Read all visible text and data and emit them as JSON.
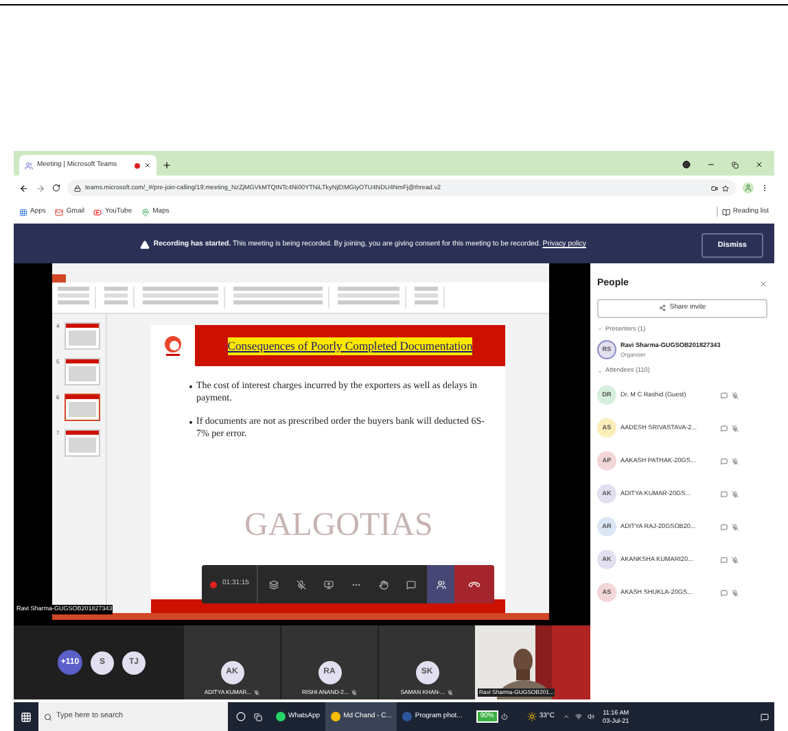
{
  "browser": {
    "tab_title": "Meeting | Microsoft Teams",
    "url": "teams.microsoft.com/_#/pre-join-calling/19:meeting_NzZjMGVkMTQtNTc4Ni00YTNiLTkyNjEtMGIyOTU4NDU4NmFj@thread.v2",
    "bookmarks": [
      "Apps",
      "Gmail",
      "YouTube",
      "Maps"
    ],
    "reading_list": "Reading list"
  },
  "banner": {
    "bold": "Recording has started.",
    "message": "This meeting is being recorded. By joining, you are giving consent for this meeting to be recorded.",
    "link": "Privacy policy",
    "button": "Dismiss"
  },
  "presentation": {
    "thumbnails": [
      {
        "number": "4",
        "selected": false
      },
      {
        "number": "5",
        "selected": false
      },
      {
        "number": "6",
        "selected": true
      },
      {
        "number": "7",
        "selected": false
      }
    ],
    "slide_title": "Consequences of Poorly Completed Documentation",
    "bullets": [
      "The cost of interest charges incurred by the exporters as well as delays in payment.",
      "If documents are not as prescribed order the buyers bank will deducted 6S-7% per error."
    ],
    "watermark": "GALGOTIAS",
    "presenter_label": "Ravi Sharma-GUGSOB201827343"
  },
  "meeting_controls": {
    "timer": "01:31:15"
  },
  "people": {
    "title": "People",
    "share_button": "Share invite",
    "presenters_heading": "Presenters (1)",
    "presenters": [
      {
        "initials": "RS",
        "name": "Ravi Sharma-GUGSOB201827343",
        "role": "Organiser"
      }
    ],
    "attendees_heading": "Attendees (110)",
    "attendees": [
      {
        "initials": "DR",
        "name": "Dr. M C Rashid (Guest)",
        "color": "#d6eedd"
      },
      {
        "initials": "AS",
        "name": "AADESH SRIVASTAVA-2...",
        "color": "#fbeeb8"
      },
      {
        "initials": "AP",
        "name": "AAKASH PATHAK-20GS...",
        "color": "#f3d6d8"
      },
      {
        "initials": "AK",
        "name": "ADITYA KUMAR-20GS...",
        "color": "#e2dff0"
      },
      {
        "initials": "AR",
        "name": "ADITYA RAJ-20GSOB20...",
        "color": "#dbe6f5"
      },
      {
        "initials": "AK",
        "name": "AKANKSHA KUMARI20...",
        "color": "#e2dff0"
      },
      {
        "initials": "AS",
        "name": "AKASH SHUKLA-20GS...",
        "color": "#f3d6d8"
      }
    ]
  },
  "gallery": {
    "overflow": "+110",
    "avatars": [
      {
        "initials": "S"
      },
      {
        "initials": "TJ"
      }
    ],
    "tiles": [
      {
        "initials": "AK",
        "name": "ADITYA KUMAR..."
      },
      {
        "initials": "RA",
        "name": "RISHI ANAND-2..."
      },
      {
        "initials": "SK",
        "name": "SAMAN KHAN-..."
      }
    ],
    "video_tile": {
      "name": "Ravi Sharma-GUGSOB201..."
    }
  },
  "taskbar": {
    "search_placeholder": "Type here to search",
    "apps": [
      "WhatsApp",
      "Md Chand - C...",
      "Program phot..."
    ],
    "battery": "90%",
    "temperature": "33°C",
    "time": "11:16 AM",
    "date": "03-Jul-21"
  }
}
